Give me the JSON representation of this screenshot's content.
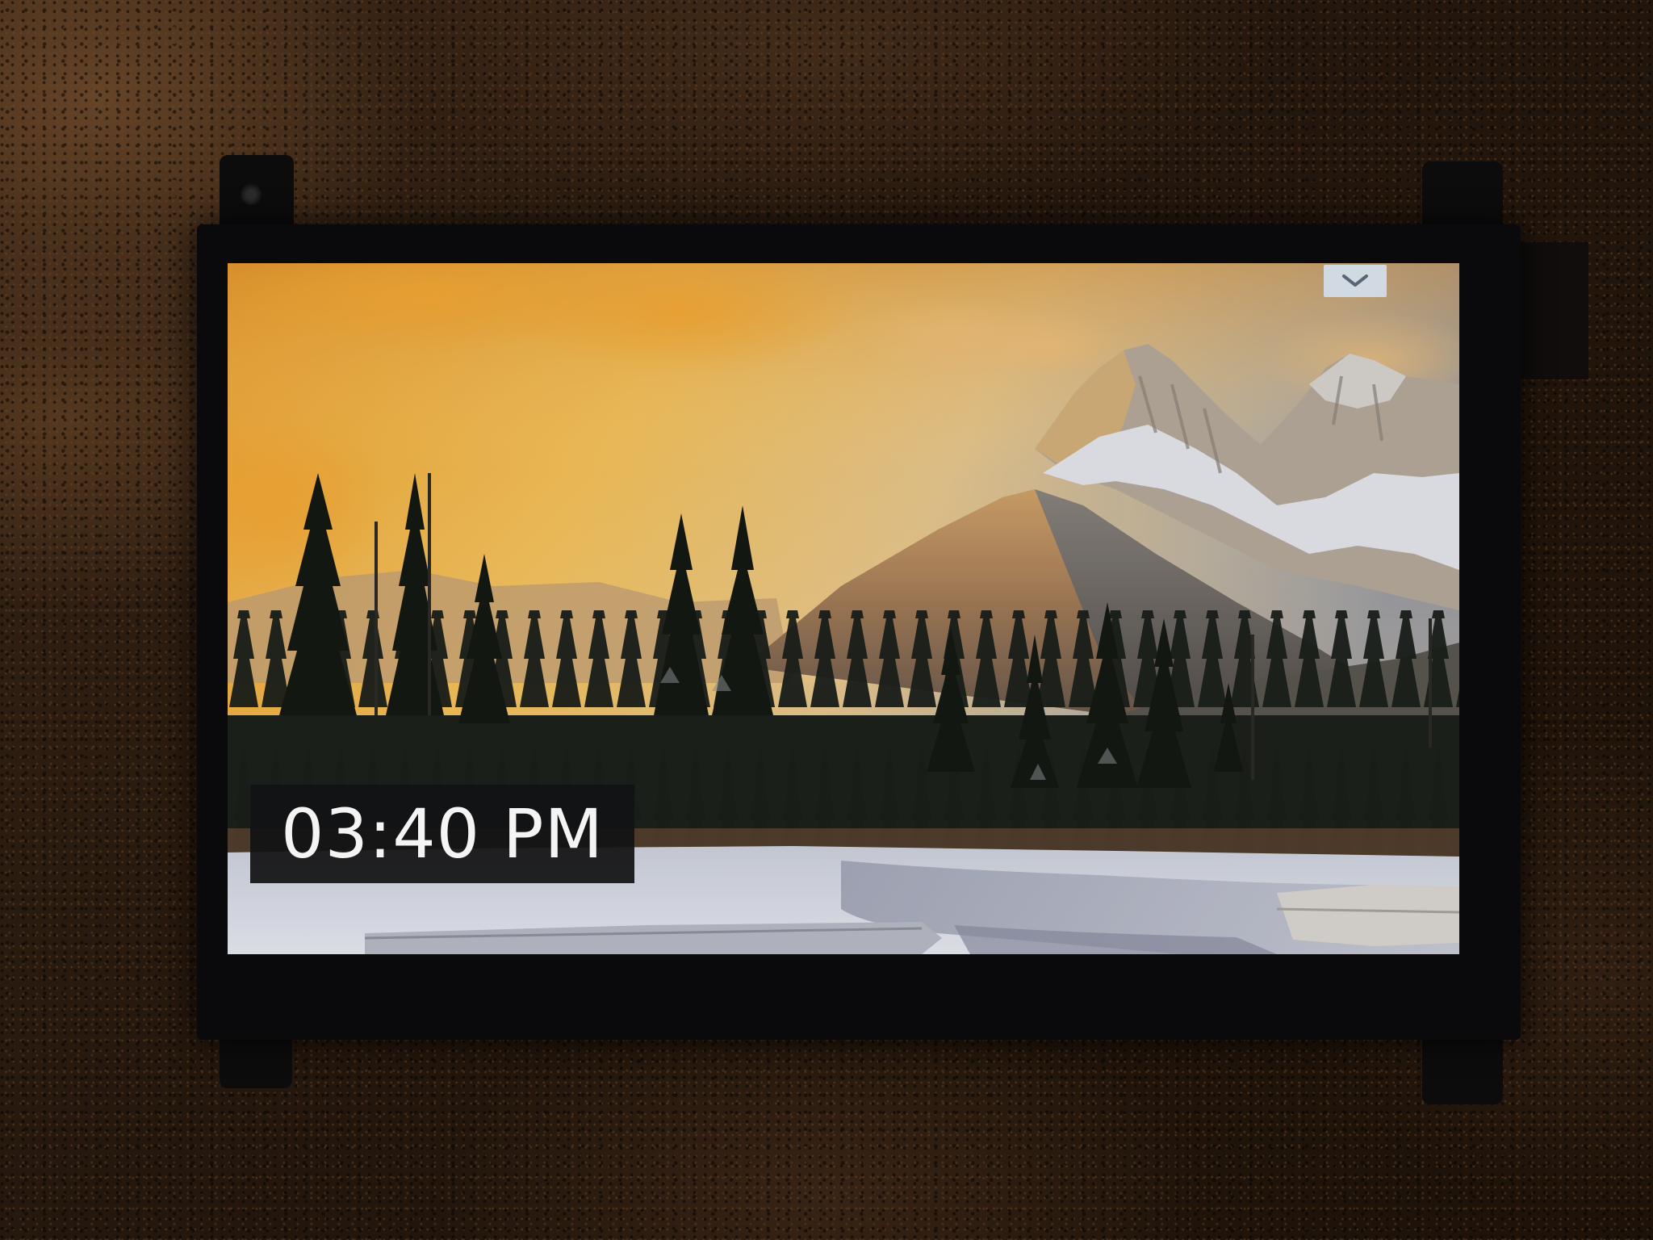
{
  "clock": {
    "time": "03:40 PM"
  },
  "menu_toggle": {
    "icon": "chevron-down-icon"
  },
  "colors": {
    "sky_warm": "#f2b545",
    "sky_cool": "#9aa2b5",
    "snow": "#d8dde8",
    "clock_background": "#121214",
    "clock_text": "#f4f4f4",
    "toggle_background": "#d2deec"
  }
}
